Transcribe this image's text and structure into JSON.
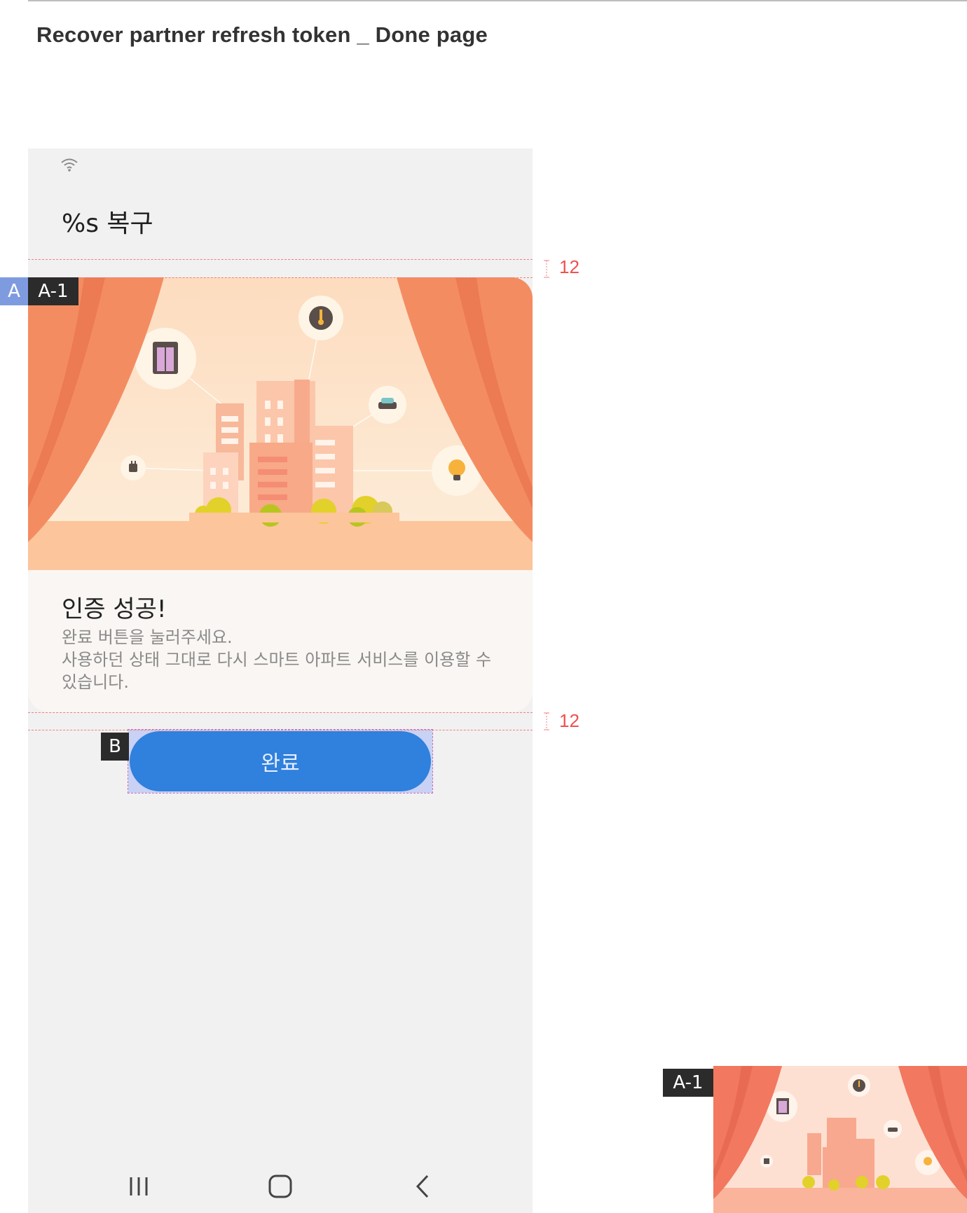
{
  "document": {
    "title": "Recover partner refresh token _ Done page"
  },
  "phone": {
    "app_title": "%s 복구",
    "card": {
      "heading": "인증 성공!",
      "line1": "완료 버튼을 눌러주세요.",
      "line2": "사용하던 상태 그대로 다시 스마트 아파트 서비스를 이용할 수 있습니다."
    },
    "done_button_label": "완료",
    "nav": [
      "recent-apps-icon",
      "home-icon",
      "back-icon"
    ]
  },
  "annotations": {
    "section_a": "A",
    "image_a1": "A-1",
    "button_b": "B",
    "thumbnail_label": "A-1",
    "spacing_top": "12",
    "spacing_bottom": "12"
  },
  "colors": {
    "curtain": "#f48c62",
    "backdrop": "#fde3c8",
    "floor": "#fcc59b",
    "button": "#3080dd",
    "spec_red": "#f05050",
    "tag_blue": "#7f9be0"
  }
}
